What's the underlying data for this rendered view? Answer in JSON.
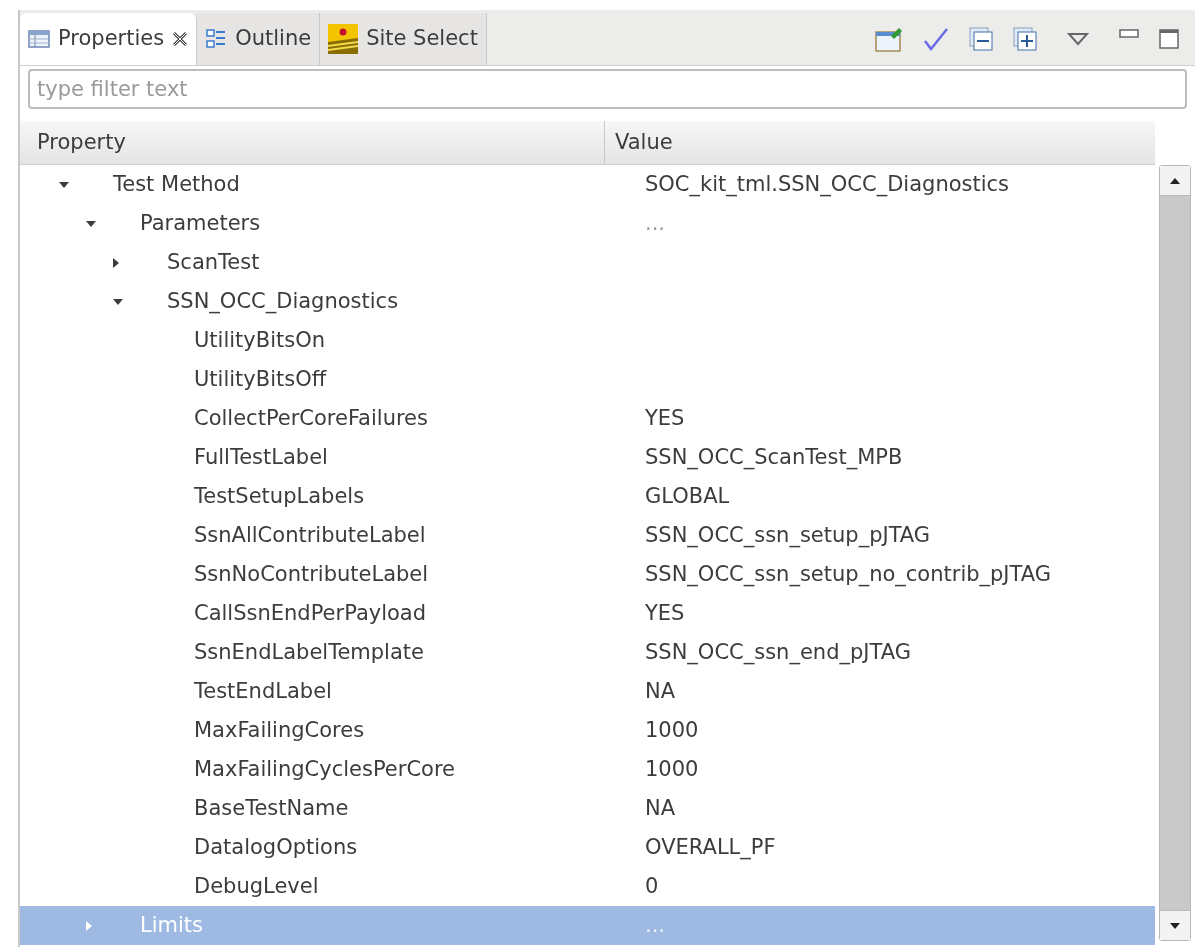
{
  "tabs": [
    {
      "label": "Properties",
      "kind": "properties",
      "selected": true,
      "closable": true
    },
    {
      "label": "Outline",
      "kind": "outline",
      "selected": false,
      "closable": false
    },
    {
      "label": "Site Select",
      "kind": "site",
      "selected": false,
      "closable": false
    }
  ],
  "filter": {
    "placeholder": "type filter text"
  },
  "columns": [
    "Property",
    "Value"
  ],
  "tree": [
    {
      "name": "Test Method",
      "value": "SOC_kit_tml.SSN_OCC_Diagnostics",
      "expanded": true,
      "selected": false,
      "children": [
        {
          "name": "Parameters",
          "value": "...",
          "dim": true,
          "expanded": true,
          "selected": false,
          "children": [
            {
              "name": "ScanTest",
              "expanded": false,
              "selected": false
            },
            {
              "name": "SSN_OCC_Diagnostics",
              "expanded": true,
              "selected": false,
              "children": [
                {
                  "name": "UtilityBitsOn",
                  "selected": false
                },
                {
                  "name": "UtilityBitsOff",
                  "selected": false
                },
                {
                  "name": "CollectPerCoreFailures",
                  "value": "YES",
                  "selected": false
                },
                {
                  "name": "FullTestLabel",
                  "value": "SSN_OCC_ScanTest_MPB",
                  "selected": false
                },
                {
                  "name": "TestSetupLabels",
                  "value": "GLOBAL",
                  "selected": false
                },
                {
                  "name": "SsnAllContributeLabel",
                  "value": "SSN_OCC_ssn_setup_pJTAG",
                  "selected": false
                },
                {
                  "name": "SsnNoContributeLabel",
                  "value": "SSN_OCC_ssn_setup_no_contrib_pJTAG",
                  "selected": false
                },
                {
                  "name": "CallSsnEndPerPayload",
                  "value": "YES",
                  "selected": false
                },
                {
                  "name": "SsnEndLabelTemplate",
                  "value": "SSN_OCC_ssn_end_pJTAG",
                  "selected": false
                },
                {
                  "name": "TestEndLabel",
                  "value": "NA",
                  "selected": false
                },
                {
                  "name": "MaxFailingCores",
                  "value": "1000",
                  "selected": false
                },
                {
                  "name": "MaxFailingCyclesPerCore",
                  "value": "1000",
                  "selected": false
                },
                {
                  "name": "BaseTestName",
                  "value": "NA",
                  "selected": false
                },
                {
                  "name": "DatalogOptions",
                  "value": "OVERALL_PF",
                  "selected": false
                },
                {
                  "name": "DebugLevel",
                  "value": "0",
                  "selected": false
                }
              ]
            }
          ]
        },
        {
          "name": "Limits",
          "value": "...",
          "dim": true,
          "expanded": false,
          "selected": true
        }
      ]
    }
  ]
}
